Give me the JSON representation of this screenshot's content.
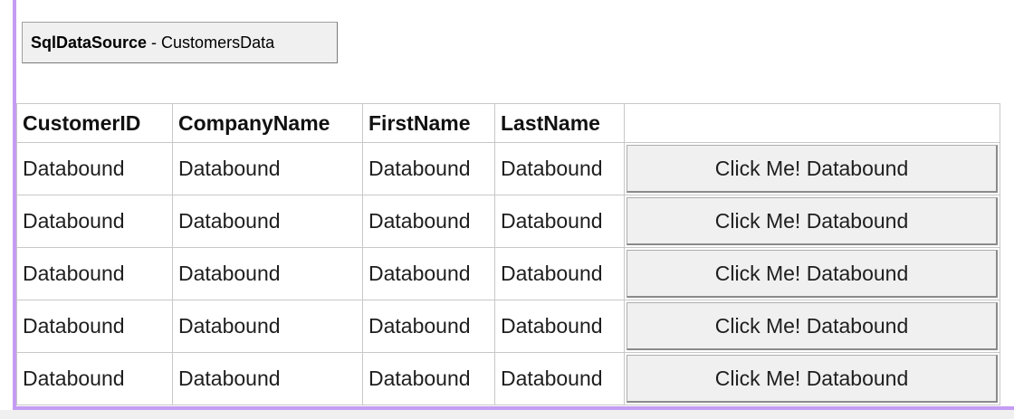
{
  "data_source": {
    "type_label": "SqlDataSource",
    "separator": " - ",
    "name": "CustomersData"
  },
  "grid": {
    "columns": [
      "CustomerID",
      "CompanyName",
      "FirstName",
      "LastName",
      ""
    ],
    "rows": [
      {
        "cells": [
          "Databound",
          "Databound",
          "Databound",
          "Databound"
        ],
        "button_label": "Click Me! Databound"
      },
      {
        "cells": [
          "Databound",
          "Databound",
          "Databound",
          "Databound"
        ],
        "button_label": "Click Me! Databound"
      },
      {
        "cells": [
          "Databound",
          "Databound",
          "Databound",
          "Databound"
        ],
        "button_label": "Click Me! Databound"
      },
      {
        "cells": [
          "Databound",
          "Databound",
          "Databound",
          "Databound"
        ],
        "button_label": "Click Me! Databound"
      },
      {
        "cells": [
          "Databound",
          "Databound",
          "Databound",
          "Databound"
        ],
        "button_label": "Click Me! Databound"
      }
    ]
  },
  "colors": {
    "selection_border": "#c49cf3",
    "grid_line": "#c8c8c8",
    "button_face": "#f0f0f0"
  }
}
